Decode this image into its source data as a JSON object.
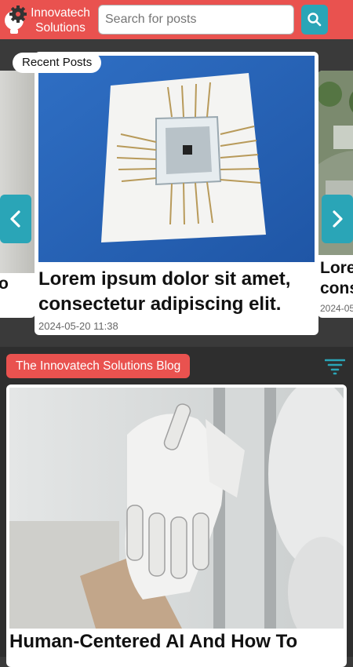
{
  "header": {
    "brand_line1": "Innovatech",
    "brand_line2": "Solutions",
    "search_placeholder": "Search for posts",
    "accent_color": "#e9524f",
    "button_color": "#2aa5b7"
  },
  "carousel": {
    "label": "Recent Posts",
    "current": {
      "title": "Lorem ipsum dolor sit amet, consectetur adipiscing elit.",
      "date": "2024-05-20 11:38"
    },
    "previous": {
      "title": "o"
    },
    "next": {
      "title_line1": "Lore",
      "title_line2": "cons",
      "date": "2024-05"
    }
  },
  "blog": {
    "label": "The Innovatech Solutions Blog",
    "post_title": "Human-Centered AI And How To"
  }
}
